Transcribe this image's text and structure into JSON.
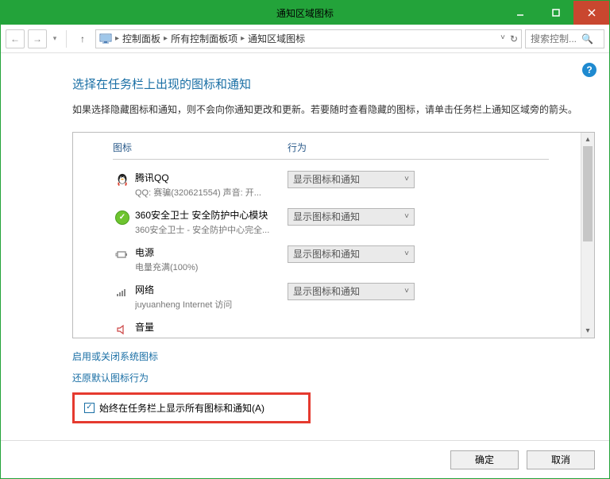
{
  "titlebar": {
    "title": "通知区域图标"
  },
  "breadcrumb": {
    "items": [
      "控制面板",
      "所有控制面板项",
      "通知区域图标"
    ]
  },
  "search": {
    "placeholder": "搜索控制..."
  },
  "heading": "选择在任务栏上出现的图标和通知",
  "description": "如果选择隐藏图标和通知，则不会向你通知更改和更新。若要随时查看隐藏的图标，请单击任务栏上通知区域旁的箭头。",
  "list": {
    "headers": {
      "icon": "图标",
      "behavior": "行为"
    },
    "default_behavior": "显示图标和通知",
    "items": [
      {
        "title": "腾讯QQ",
        "subtitle": "QQ: 赛骗(320621554)   声音: 开..."
      },
      {
        "title": "360安全卫士 安全防护中心模块",
        "subtitle": "360安全卫士 - 安全防护中心完全..."
      },
      {
        "title": "电源",
        "subtitle": "电量充满(100%)"
      },
      {
        "title": "网络",
        "subtitle": "juyuanheng Internet 访问"
      },
      {
        "title": "音量",
        "subtitle": ""
      }
    ]
  },
  "links": {
    "toggle_system_icons": "启用或关闭系统图标",
    "restore_defaults": "还原默认图标行为"
  },
  "checkbox": {
    "label": "始终在任务栏上显示所有图标和通知(A)"
  },
  "buttons": {
    "ok": "确定",
    "cancel": "取消"
  }
}
